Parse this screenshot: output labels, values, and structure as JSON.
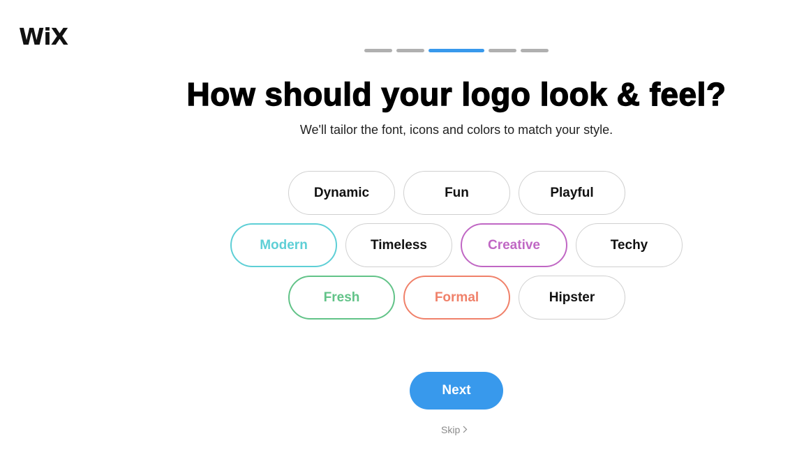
{
  "brand": {
    "logo_text": "WiX"
  },
  "progress": {
    "total_steps": 5,
    "current_step": 3
  },
  "header": {
    "title": "How should your logo look & feel?",
    "subtitle": "We'll tailor the font, icons and colors to match your style."
  },
  "styles": {
    "rows": [
      [
        {
          "label": "Dynamic",
          "selected": false,
          "color": "#111111"
        },
        {
          "label": "Fun",
          "selected": false,
          "color": "#111111"
        },
        {
          "label": "Playful",
          "selected": false,
          "color": "#111111"
        }
      ],
      [
        {
          "label": "Modern",
          "selected": true,
          "color": "#5ecfd6"
        },
        {
          "label": "Timeless",
          "selected": false,
          "color": "#111111"
        },
        {
          "label": "Creative",
          "selected": true,
          "color": "#c067c4"
        },
        {
          "label": "Techy",
          "selected": false,
          "color": "#111111"
        }
      ],
      [
        {
          "label": "Fresh",
          "selected": true,
          "color": "#62c388"
        },
        {
          "label": "Formal",
          "selected": true,
          "color": "#f0816a"
        },
        {
          "label": "Hipster",
          "selected": false,
          "color": "#111111"
        }
      ]
    ]
  },
  "actions": {
    "next_label": "Next",
    "skip_label": "Skip",
    "skip_icon": "chevron-right-icon"
  },
  "colors": {
    "accent": "#3899ec",
    "progress_inactive": "#b0b0b0"
  }
}
